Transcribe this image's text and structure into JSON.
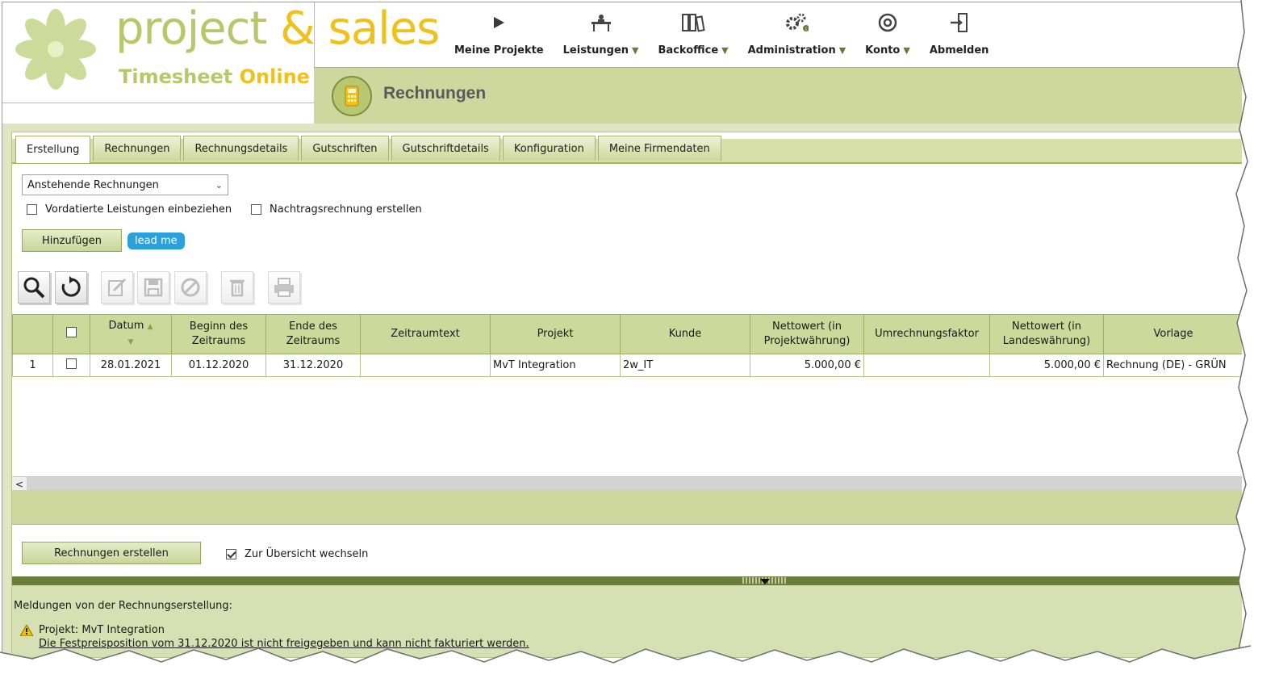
{
  "brand": {
    "title_part1": "project",
    "title_amp": "&",
    "title_part2": "sales",
    "subtitle_part1": "Timesheet",
    "subtitle_part2": "Online"
  },
  "nav": [
    {
      "label": "Meine Projekte",
      "icon": "play-icon",
      "has_menu": false
    },
    {
      "label": "Leistungen",
      "icon": "desk-icon",
      "has_menu": true
    },
    {
      "label": "Backoffice",
      "icon": "binders-icon",
      "has_menu": true
    },
    {
      "label": "Administration",
      "icon": "gears-icon",
      "has_menu": true
    },
    {
      "label": "Konto",
      "icon": "at-sign-icon",
      "has_menu": true
    },
    {
      "label": "Abmelden",
      "icon": "logout-icon",
      "has_menu": false
    }
  ],
  "nav_arrow": "▼",
  "page_title": "Rechnungen",
  "tabs": [
    {
      "label": "Erstellung",
      "active": true
    },
    {
      "label": "Rechnungen",
      "active": false
    },
    {
      "label": "Rechnungsdetails",
      "active": false
    },
    {
      "label": "Gutschriften",
      "active": false
    },
    {
      "label": "Gutschriftdetails",
      "active": false
    },
    {
      "label": "Konfiguration",
      "active": false
    },
    {
      "label": "Meine Firmendaten",
      "active": false
    }
  ],
  "form": {
    "select_value": "Anstehende Rechnungen",
    "cb_vordatiert": "Vordatierte Leistungen einbeziehen",
    "cb_vordatiert_checked": false,
    "cb_nachtrag": "Nachtragsrechnung erstellen",
    "cb_nachtrag_checked": false,
    "add_button": "Hinzufügen",
    "lead_me": "lead me"
  },
  "toolbar": [
    {
      "icon": "search-icon",
      "enabled": true
    },
    {
      "icon": "refresh-icon",
      "enabled": true
    },
    {
      "icon": "edit-icon",
      "enabled": false
    },
    {
      "icon": "save-icon",
      "enabled": false
    },
    {
      "icon": "cancel-icon",
      "enabled": false
    },
    {
      "icon": "trash-icon",
      "enabled": false
    },
    {
      "icon": "print-icon",
      "enabled": false
    }
  ],
  "table": {
    "columns": [
      "",
      "",
      "Datum",
      "Beginn des Zeitraums",
      "Ende des Zeitraums",
      "Zeitraumtext",
      "Projekt",
      "Kunde",
      "Nettowert (in Projektwährung)",
      "Umrechnungsfaktor",
      "Nettowert (in Landeswährung)",
      "Vorlage"
    ],
    "rows": [
      {
        "nr": "1",
        "checked": false,
        "datum": "28.01.2021",
        "beginn": "01.12.2020",
        "ende": "31.12.2020",
        "zeitraumtext": "",
        "projekt": "MvT Integration",
        "kunde": "2w_IT",
        "netto_projekt": "5.000,00 €",
        "faktor": "",
        "netto_land": "5.000,00 €",
        "vorlage": "Rechnung (DE) - GRÜN"
      }
    ]
  },
  "bottom": {
    "create_button": "Rechnungen erstellen",
    "cb_overview": "Zur Übersicht wechseln",
    "cb_overview_checked": true
  },
  "messages": {
    "heading": "Meldungen von der Rechnungserstellung:",
    "line1": "Projekt: MvT Integration",
    "line2": "Die Festpreisposition vom 31.12.2020 ist nicht freigegeben und kann nicht fakturiert werden."
  },
  "colors": {
    "accent_green": "#cdd79e",
    "dark_green": "#6a7d3b",
    "brand_yellow": "#f0c11a",
    "brand_green": "#b6c96a",
    "lead_me_blue": "#2aa0dc"
  }
}
